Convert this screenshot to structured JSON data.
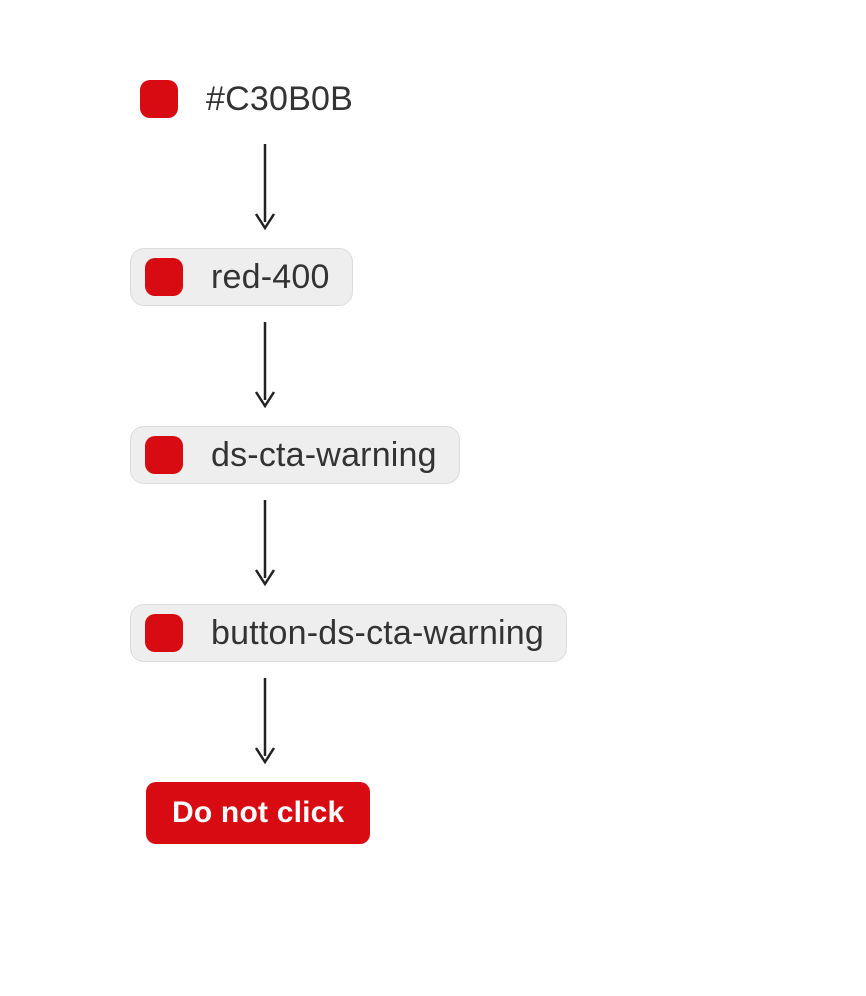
{
  "diagram": {
    "swatch_color": "#d70b11",
    "steps": [
      {
        "label": "#C30B0B",
        "boxed": false
      },
      {
        "label": "red-400",
        "boxed": true
      },
      {
        "label": "ds-cta-warning",
        "boxed": true
      },
      {
        "label": "button-ds-cta-warning",
        "boxed": true
      }
    ],
    "button_label": "Do not click"
  }
}
